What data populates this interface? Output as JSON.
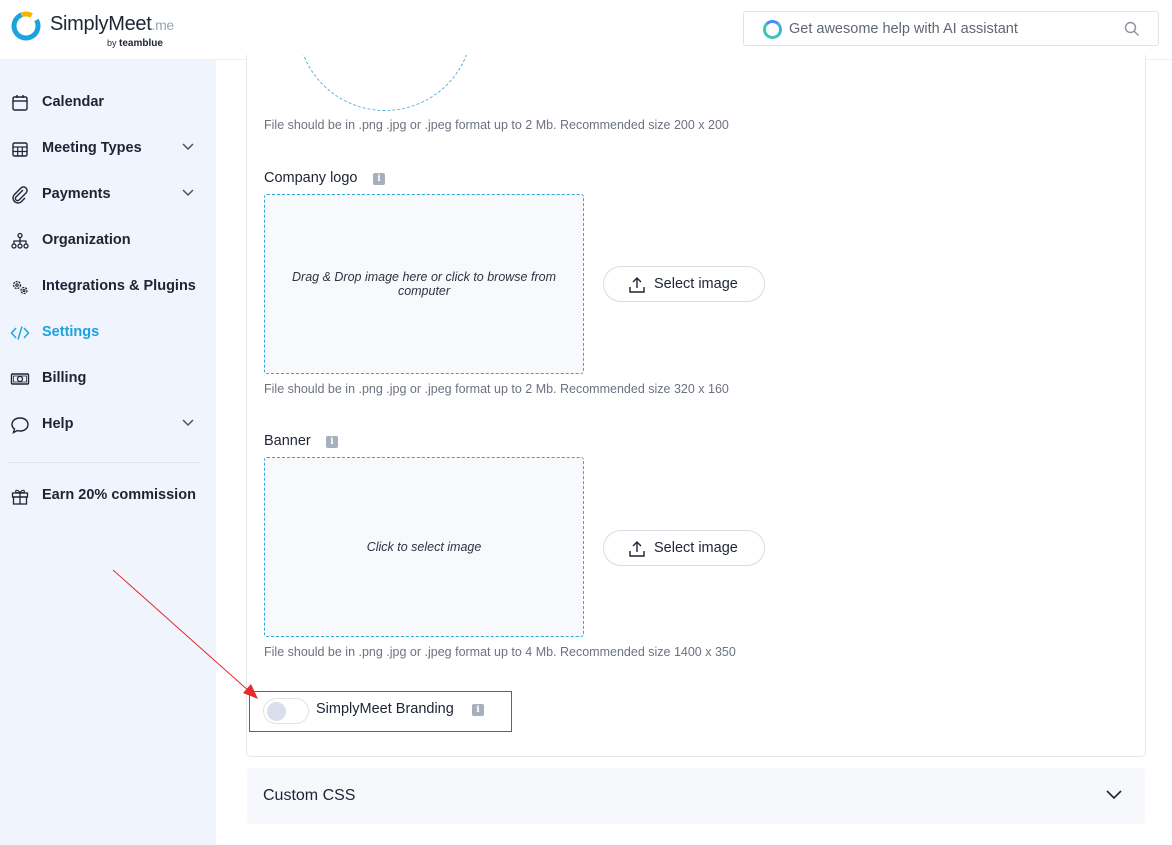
{
  "header": {
    "brand_name": "SimplyMeet",
    "brand_suffix": ".me",
    "by_text": "by",
    "by_company": "teamblue",
    "search_placeholder": "Get awesome help with AI assistant"
  },
  "sidebar": {
    "items": [
      {
        "label": "Calendar",
        "icon": "calendar-icon"
      },
      {
        "label": "Meeting Types",
        "icon": "grid-calendar-icon",
        "expandable": true
      },
      {
        "label": "Payments",
        "icon": "paperclip-icon",
        "expandable": true
      },
      {
        "label": "Organization",
        "icon": "org-chart-icon"
      },
      {
        "label": "Integrations & Plugins",
        "icon": "gears-icon"
      },
      {
        "label": "Settings",
        "icon": "code-icon",
        "active": true
      },
      {
        "label": "Billing",
        "icon": "banknote-icon"
      },
      {
        "label": "Help",
        "icon": "chat-bubble-icon",
        "expandable": true
      }
    ],
    "earn": {
      "label": "Earn 20% commission",
      "icon": "gift-icon"
    }
  },
  "main": {
    "avatar_hint": "File should be in .png .jpg or .jpeg format up to 2 Mb. Recommended size 200 x 200",
    "company_logo": {
      "label": "Company logo",
      "info": "i",
      "dropzone_text": "Drag & Drop image here or click to browse from computer",
      "button": "Select image",
      "hint": "File should be in .png .jpg or .jpeg format up to 2 Mb. Recommended size 320 x 160"
    },
    "banner": {
      "label": "Banner",
      "info": "i",
      "dropzone_text": "Click to select image",
      "button": "Select image",
      "hint": "File should be in .png .jpg or .jpeg format up to 4 Mb. Recommended size 1400 x 350"
    },
    "branding": {
      "label": "SimplyMeet Branding",
      "info": "i",
      "enabled": false
    },
    "custom_css": {
      "label": "Custom CSS"
    }
  },
  "colors": {
    "accent": "#1aa3de",
    "sidebar_bg": "#f0f4fc",
    "annotation_red": "#e52b2b"
  }
}
